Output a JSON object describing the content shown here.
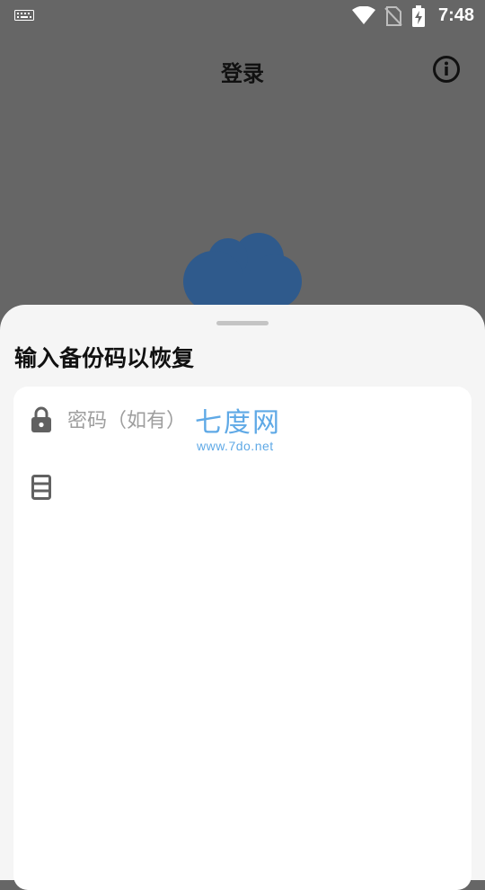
{
  "status_bar": {
    "time": "7:48",
    "icons": [
      "keyboard-icon",
      "wifi-icon",
      "no-sim-icon",
      "battery-charging-icon"
    ]
  },
  "header": {
    "title": "登录",
    "info_icon": "info-icon"
  },
  "background": {
    "logo_icon": "cloud-icon",
    "logo_color": "#2f5a8c"
  },
  "sheet": {
    "title": "输入备份码以恢复",
    "password_field": {
      "placeholder": "密码（如有）",
      "value": "",
      "icon": "lock-icon"
    },
    "backup_code_field": {
      "placeholder": "",
      "value": "",
      "icon": "list-icon"
    }
  },
  "watermark": {
    "name": "七度网",
    "url": "www.7do.net"
  },
  "colors": {
    "overlay": "#666666",
    "sheet": "#f5f5f5",
    "card": "#ffffff",
    "watermark": "#5fa9e6"
  }
}
